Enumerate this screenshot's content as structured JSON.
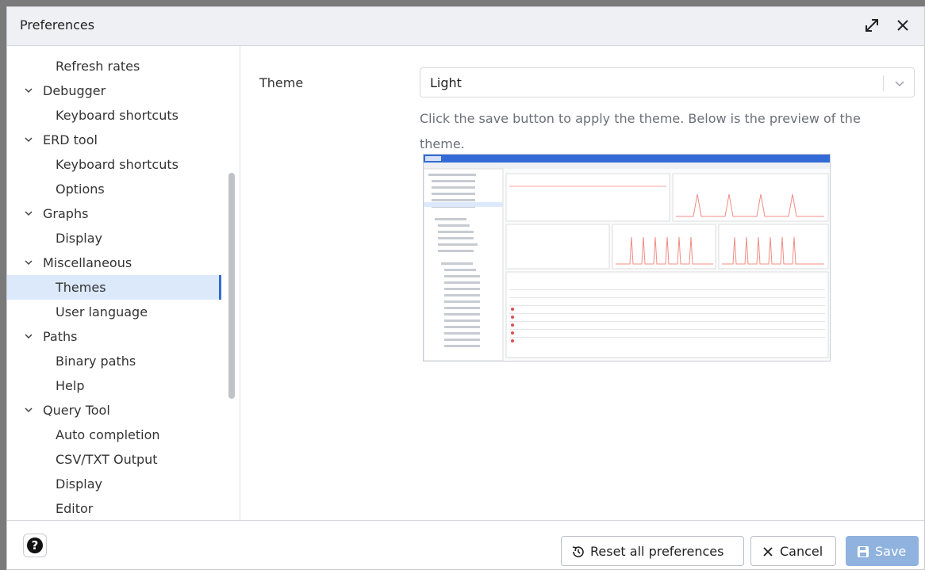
{
  "window": {
    "title": "Preferences"
  },
  "sidebar": {
    "items": [
      {
        "label": "Refresh rates",
        "kind": "child"
      },
      {
        "label": "Debugger",
        "kind": "group"
      },
      {
        "label": "Keyboard shortcuts",
        "kind": "child"
      },
      {
        "label": "ERD tool",
        "kind": "group"
      },
      {
        "label": "Keyboard shortcuts",
        "kind": "child"
      },
      {
        "label": "Options",
        "kind": "child"
      },
      {
        "label": "Graphs",
        "kind": "group"
      },
      {
        "label": "Display",
        "kind": "child"
      },
      {
        "label": "Miscellaneous",
        "kind": "group"
      },
      {
        "label": "Themes",
        "kind": "child",
        "selected": true
      },
      {
        "label": "User language",
        "kind": "child"
      },
      {
        "label": "Paths",
        "kind": "group"
      },
      {
        "label": "Binary paths",
        "kind": "child"
      },
      {
        "label": "Help",
        "kind": "child"
      },
      {
        "label": "Query Tool",
        "kind": "group"
      },
      {
        "label": "Auto completion",
        "kind": "child"
      },
      {
        "label": "CSV/TXT Output",
        "kind": "child"
      },
      {
        "label": "Display",
        "kind": "child"
      },
      {
        "label": "Editor",
        "kind": "child"
      }
    ]
  },
  "main": {
    "theme_label": "Theme",
    "theme_value": "Light",
    "hint": "Click the save button to apply the theme. Below is the preview of the theme."
  },
  "footer": {
    "reset_label": "Reset all preferences",
    "cancel_label": "Cancel",
    "save_label": "Save"
  },
  "icons": {
    "maximize": "expand-icon",
    "close": "close-icon",
    "help": "help-icon",
    "reset": "reset-icon",
    "cancel": "close-icon",
    "save": "save-icon",
    "chevron": "chevron-down-icon"
  },
  "colors": {
    "accent": "#326bd6",
    "selected_bg": "#dbe9fb",
    "save_bg": "#8fb2de"
  }
}
